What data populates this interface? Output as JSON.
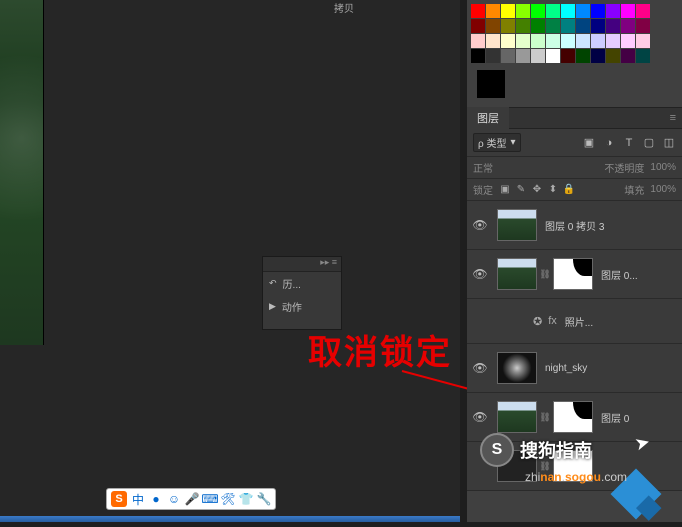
{
  "top": {
    "thumb_label": "拷贝"
  },
  "mini_panel": {
    "collapse": "▸▸ ≡",
    "history_icon": "↶",
    "history_label": "历...",
    "actions_icon": "▶",
    "actions_label": "动作"
  },
  "annotation": {
    "text": "取消锁定"
  },
  "ime": {
    "logo": "S",
    "items": [
      "中",
      "●",
      "☺",
      "🎤",
      "⌨",
      "🛠",
      "👕",
      "🔧"
    ]
  },
  "swatches": {
    "rows": [
      [
        "#ff0000",
        "#ff8800",
        "#ffff00",
        "#88ff00",
        "#00ff00",
        "#00ff88",
        "#00ffff",
        "#0088ff",
        "#0000ff",
        "#8800ff",
        "#ff00ff",
        "#ff0088"
      ],
      [
        "#800000",
        "#804400",
        "#808000",
        "#448000",
        "#008000",
        "#008044",
        "#008080",
        "#004480",
        "#000080",
        "#440080",
        "#800080",
        "#800044"
      ],
      [
        "#ffcccc",
        "#ffe5cc",
        "#ffffcc",
        "#e5ffcc",
        "#ccffcc",
        "#ccffe5",
        "#ccffff",
        "#cce5ff",
        "#ccccff",
        "#e5ccff",
        "#ffccff",
        "#ffcce5"
      ],
      [
        "#000000",
        "#333333",
        "#666666",
        "#999999",
        "#cccccc",
        "#ffffff",
        "#400",
        "#040",
        "#004",
        "#440",
        "#404",
        "#044"
      ]
    ],
    "big": [
      "#000000",
      "#ffffff"
    ]
  },
  "layers_panel": {
    "tab": "图层",
    "menu": "≡",
    "filter": {
      "kind_label": "ρ 类型",
      "kind_caret": "▾",
      "icons": [
        "▣",
        "◑",
        "T",
        "▢",
        "◫"
      ]
    },
    "mode": {
      "label": "正常",
      "opacity_label": "不透明度",
      "opacity_value": "100%"
    },
    "lock": {
      "label": "锁定",
      "icons": [
        "▣",
        "✎",
        "✥",
        "⬍",
        "🔒"
      ],
      "fill_label": "填充",
      "fill_value": "100%"
    },
    "layers": [
      {
        "visible": true,
        "thumbs": [
          "forest"
        ],
        "name": "图层 0 拷贝 3"
      },
      {
        "visible": true,
        "thumbs": [
          "forest",
          "link",
          "mask"
        ],
        "name": "图层 0..."
      },
      {
        "visible": false,
        "fx": true,
        "name": "照片..."
      },
      {
        "visible": true,
        "thumbs": [
          "night"
        ],
        "name": "night_sky"
      },
      {
        "visible": true,
        "thumbs": [
          "forest",
          "link",
          "mask"
        ],
        "name": "图层 0"
      },
      {
        "visible": false,
        "thumbs": [
          "dark",
          "link",
          "white"
        ],
        "name": ""
      }
    ],
    "eye": "👁",
    "fx_icon": "✪",
    "link_icon": "⛓"
  },
  "credit": {
    "logo_letter": "S",
    "brand": "搜狗指南",
    "url_pre": "zhi",
    "url_mid": "nan",
    "url_mid2": "sogou",
    "url_post": ".com"
  },
  "cursor": "➤"
}
